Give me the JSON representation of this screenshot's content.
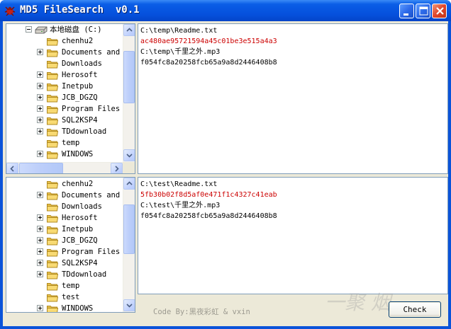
{
  "window": {
    "title": "MD5 FileSearch  v0.1"
  },
  "tree_top": {
    "items": [
      {
        "label": "本地磁盘 (C:)",
        "kind": "drive",
        "expander": "minus"
      },
      {
        "label": "chenhu2",
        "kind": "folder",
        "expander": ""
      },
      {
        "label": "Documents and",
        "kind": "folder",
        "expander": "plus"
      },
      {
        "label": "Downloads",
        "kind": "folder",
        "expander": ""
      },
      {
        "label": "Herosoft",
        "kind": "folder",
        "expander": "plus"
      },
      {
        "label": "Inetpub",
        "kind": "folder",
        "expander": "plus"
      },
      {
        "label": "JCB_DGZQ",
        "kind": "folder",
        "expander": "plus"
      },
      {
        "label": "Program Files",
        "kind": "folder",
        "expander": "plus"
      },
      {
        "label": "SQL2KSP4",
        "kind": "folder",
        "expander": "plus"
      },
      {
        "label": "TDdownload",
        "kind": "folder",
        "expander": "plus"
      },
      {
        "label": "temp",
        "kind": "folder",
        "expander": ""
      },
      {
        "label": "WINDOWS",
        "kind": "folder",
        "expander": "plus"
      }
    ]
  },
  "tree_bottom": {
    "items": [
      {
        "label": "chenhu2",
        "kind": "folder",
        "expander": ""
      },
      {
        "label": "Documents and",
        "kind": "folder",
        "expander": "plus"
      },
      {
        "label": "Downloads",
        "kind": "folder",
        "expander": ""
      },
      {
        "label": "Herosoft",
        "kind": "folder",
        "expander": "plus"
      },
      {
        "label": "Inetpub",
        "kind": "folder",
        "expander": "plus"
      },
      {
        "label": "JCB_DGZQ",
        "kind": "folder",
        "expander": "plus"
      },
      {
        "label": "Program Files",
        "kind": "folder",
        "expander": "plus"
      },
      {
        "label": "SQL2KSP4",
        "kind": "folder",
        "expander": "plus"
      },
      {
        "label": "TDdownload",
        "kind": "folder",
        "expander": "plus"
      },
      {
        "label": "temp",
        "kind": "folder",
        "expander": ""
      },
      {
        "label": "test",
        "kind": "folder",
        "expander": ""
      },
      {
        "label": "WINDOWS",
        "kind": "folder",
        "expander": "plus"
      }
    ]
  },
  "results_top": {
    "lines": [
      {
        "text": "C:\\temp\\Readme.txt",
        "color": "#000000"
      },
      {
        "text": "ac480ae95721594a45c01be3e515a4a3",
        "color": "#CC0000"
      },
      {
        "text": "C:\\temp\\千里之外.mp3",
        "color": "#000000"
      },
      {
        "text": "f054fc8a20258fcb65a9a8d2446408b8",
        "color": "#000000"
      }
    ]
  },
  "results_bottom": {
    "lines": [
      {
        "text": "C:\\test\\Readme.txt",
        "color": "#000000"
      },
      {
        "text": "5fb30b02f8d5af0e471f1c4327c41eab",
        "color": "#CC0000"
      },
      {
        "text": "C:\\test\\千里之外.mp3",
        "color": "#000000"
      },
      {
        "text": "f054fc8a20258fcb65a9a8d2446408b8",
        "color": "#000000"
      }
    ]
  },
  "footer": {
    "credit": "Code By:黑夜彩虹 & vxin",
    "check_label": "Check",
    "watermark": "一聚 烟"
  },
  "colors": {
    "title_bar": "#0550DC",
    "client_bg": "#ECE9D8",
    "highlight_hash": "#CC0000"
  }
}
